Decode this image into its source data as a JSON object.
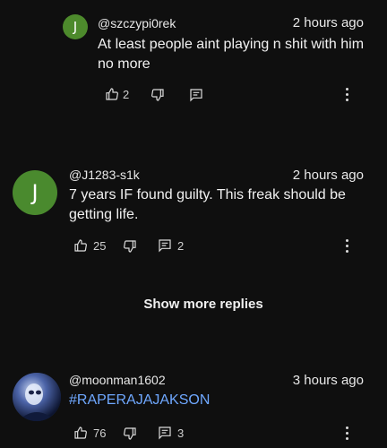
{
  "comments": [
    {
      "avatar_letter": "J",
      "avatar_color": "#4d8a2c",
      "handle": "@szczypi0rek",
      "time": "2 hours ago",
      "text_line1": "At least people aint playing n shit with him",
      "text_line2": "no more",
      "likes": "2",
      "replies": ""
    },
    {
      "avatar_letter": "J",
      "avatar_color": "#4a8a2e",
      "handle": "@J1283-s1k",
      "time": "2 hours ago",
      "text_line1": "7 years IF found guilty. This freak should be",
      "text_line2": "getting life.",
      "likes": "25",
      "replies": "2"
    },
    {
      "avatar_icon": "profile-photo",
      "handle": "@moonman1602",
      "time": "3 hours ago",
      "text_line1": "#RAPERAJAJAKSON",
      "likes": "76",
      "replies": "3"
    }
  ],
  "show_more_label": "Show more replies",
  "colors": {
    "background": "#0f0f0f",
    "link": "#6fa8ff",
    "text": "#f1f1f1"
  }
}
